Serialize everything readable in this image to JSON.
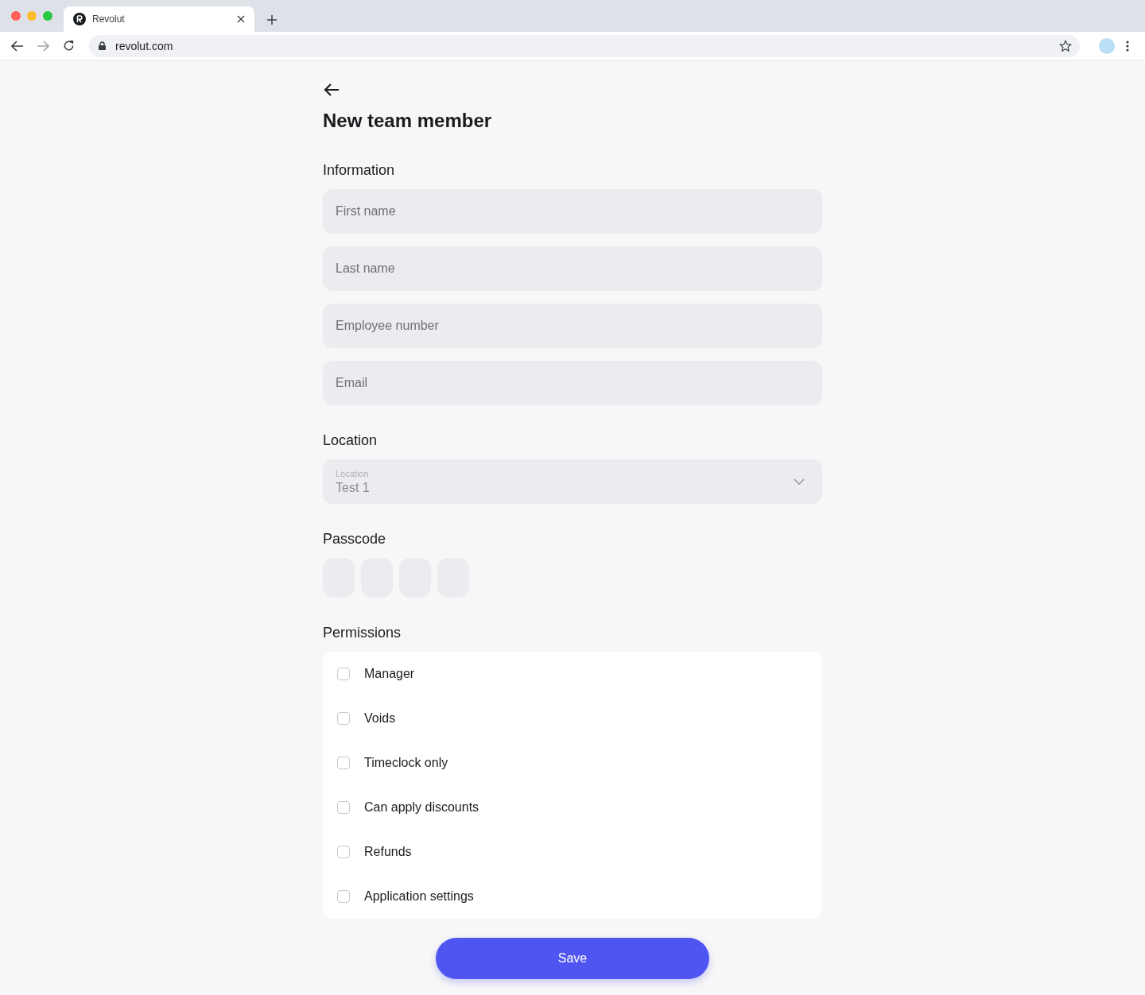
{
  "browser": {
    "tab": {
      "title": "Revolut"
    },
    "url": "revolut.com"
  },
  "page": {
    "title": "New team member",
    "information": {
      "heading": "Information",
      "fields": [
        {
          "placeholder": "First name"
        },
        {
          "placeholder": "Last name"
        },
        {
          "placeholder": "Employee number"
        },
        {
          "placeholder": "Email"
        }
      ]
    },
    "location": {
      "heading": "Location",
      "select": {
        "label": "Location",
        "value": "Test 1"
      }
    },
    "passcode": {
      "heading": "Passcode",
      "digits": [
        {
          "filled": false
        },
        {
          "filled": false
        },
        {
          "filled": false
        },
        {
          "filled": false
        }
      ]
    },
    "permissions": {
      "heading": "Permissions",
      "items": [
        {
          "label": "Manager",
          "checked": false
        },
        {
          "label": "Voids",
          "checked": false
        },
        {
          "label": "Timeclock only",
          "checked": false
        },
        {
          "label": "Can apply discounts",
          "checked": false
        },
        {
          "label": "Refunds",
          "checked": false
        },
        {
          "label": "Application settings",
          "checked": false
        }
      ]
    },
    "save_button": "Save"
  }
}
